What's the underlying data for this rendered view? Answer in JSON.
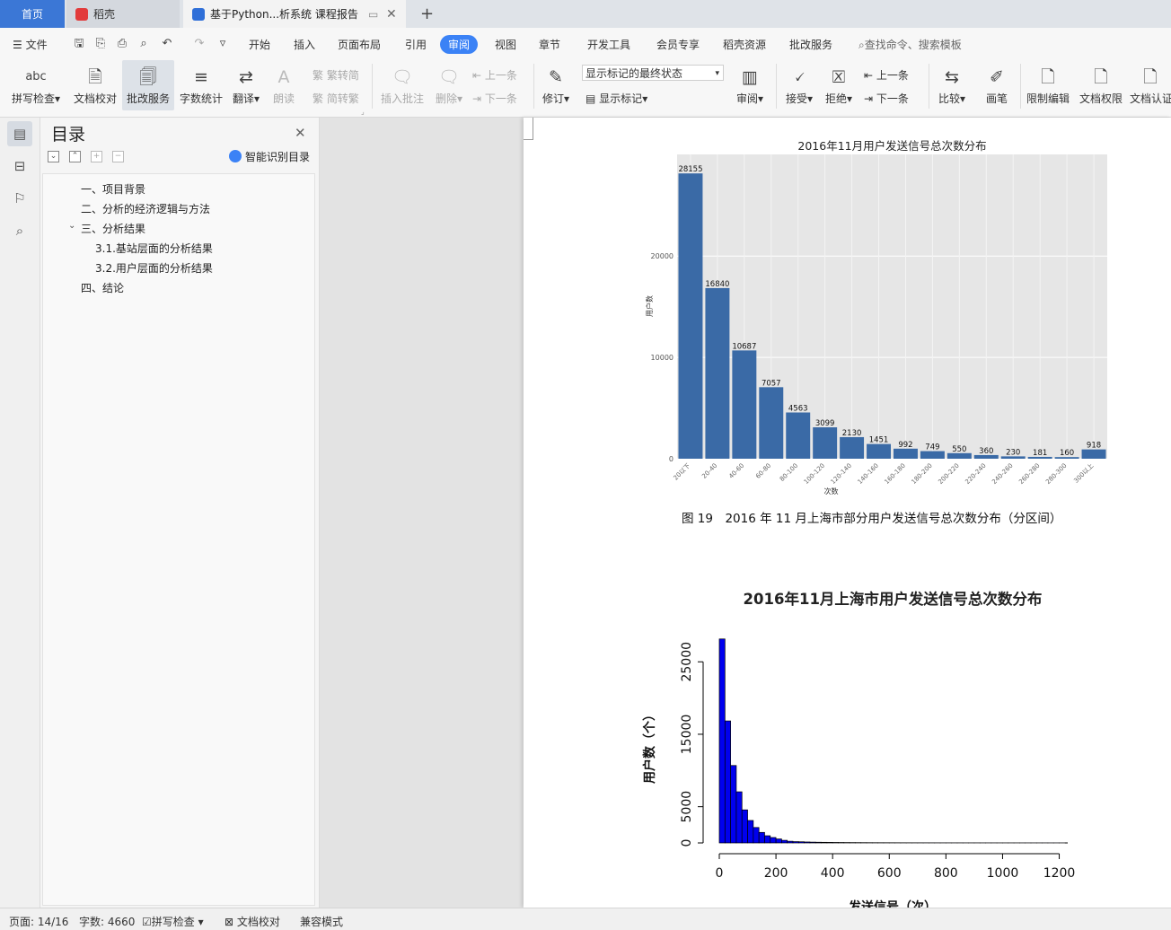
{
  "tabs": {
    "home": "首页",
    "daoke": "稻壳",
    "doc": "基于Python...析系统 课程报告"
  },
  "menubar": {
    "file": "文件",
    "items": [
      "开始",
      "插入",
      "页面布局",
      "引用",
      "审阅",
      "视图",
      "章节",
      "开发工具",
      "会员专享",
      "稻壳资源",
      "批改服务"
    ],
    "active_index": 4,
    "search": "查找命令、搜索模板"
  },
  "ribbon": {
    "spellcheck": "拼写检查",
    "doccheck": "文档校对",
    "correction": "批改服务",
    "wordcount": "字数统计",
    "translate": "翻译",
    "read": "朗读",
    "trad2simp": "繁转简",
    "simp2trad": "简转繁",
    "insert_comment": "插入批注",
    "delete": "删除",
    "prev": "上一条",
    "next": "下一条",
    "revise": "修订",
    "markup_state": "显示标记的最终状态",
    "show_markup": "显示标记",
    "review": "审阅",
    "accept": "接受",
    "reject": "拒绝",
    "prev2": "上一条",
    "next2": "下一条",
    "compare": "比较",
    "pen": "画笔",
    "restrict": "限制编辑",
    "permission": "文档权限",
    "certify": "文档认证"
  },
  "toc": {
    "title": "目录",
    "smart": "智能识别目录",
    "items": [
      "一、项目背景",
      "二、分析的经济逻辑与方法",
      "三、分析结果",
      "3.1.基站层面的分析结果",
      "3.2.用户层面的分析结果",
      "四、结论"
    ]
  },
  "caption": "图 19　2016 年 11 月上海市部分用户发送信号总次数分布（分区间）",
  "status": {
    "page": "页面: 14/16",
    "words": "字数: 4660",
    "spell": "拼写检查",
    "doccheck": "文档校对",
    "compat": "兼容模式"
  },
  "chart_data": [
    {
      "type": "bar",
      "title": "2016年11月用户发送信号总次数分布",
      "xlabel": "次数",
      "ylabel": "用户数",
      "categories": [
        "20以下",
        "20-40",
        "40-60",
        "60-80",
        "80-100",
        "100-120",
        "120-140",
        "140-160",
        "160-180",
        "180-200",
        "200-220",
        "220-240",
        "240-260",
        "260-280",
        "280-300",
        "300以上"
      ],
      "values": [
        28155,
        16840,
        10687,
        7057,
        4563,
        3099,
        2130,
        1451,
        992,
        749,
        550,
        360,
        230,
        181,
        160,
        918
      ],
      "yticks": [
        0,
        10000,
        20000
      ],
      "ylim": [
        0,
        29500
      ],
      "color": "#3a6aa6",
      "grid": true
    },
    {
      "type": "bar",
      "title": "2016年11月上海市用户发送信号总次数分布",
      "xlabel": "发送信号（次）",
      "ylabel": "用户数（个）",
      "xticks": [
        0,
        200,
        400,
        600,
        800,
        1000,
        1200
      ],
      "yticks": [
        0,
        5000,
        15000,
        25000
      ],
      "bin_width": 20,
      "values": [
        28155,
        16840,
        10687,
        7057,
        4563,
        3099,
        2130,
        1451,
        992,
        749,
        550,
        360,
        230,
        181,
        160,
        130,
        110,
        95,
        85,
        75,
        65,
        58,
        50,
        44,
        40,
        36,
        32,
        29,
        27,
        25,
        23,
        21,
        19,
        18,
        17,
        16,
        15,
        14,
        13,
        12,
        12,
        11,
        11,
        10,
        10,
        10,
        9,
        9,
        9,
        8,
        8,
        8,
        8,
        7,
        7,
        7,
        7,
        7,
        6,
        6,
        6
      ],
      "xlim": [
        0,
        1230
      ],
      "ylim": [
        0,
        28500
      ],
      "color": "#0000ee"
    }
  ]
}
